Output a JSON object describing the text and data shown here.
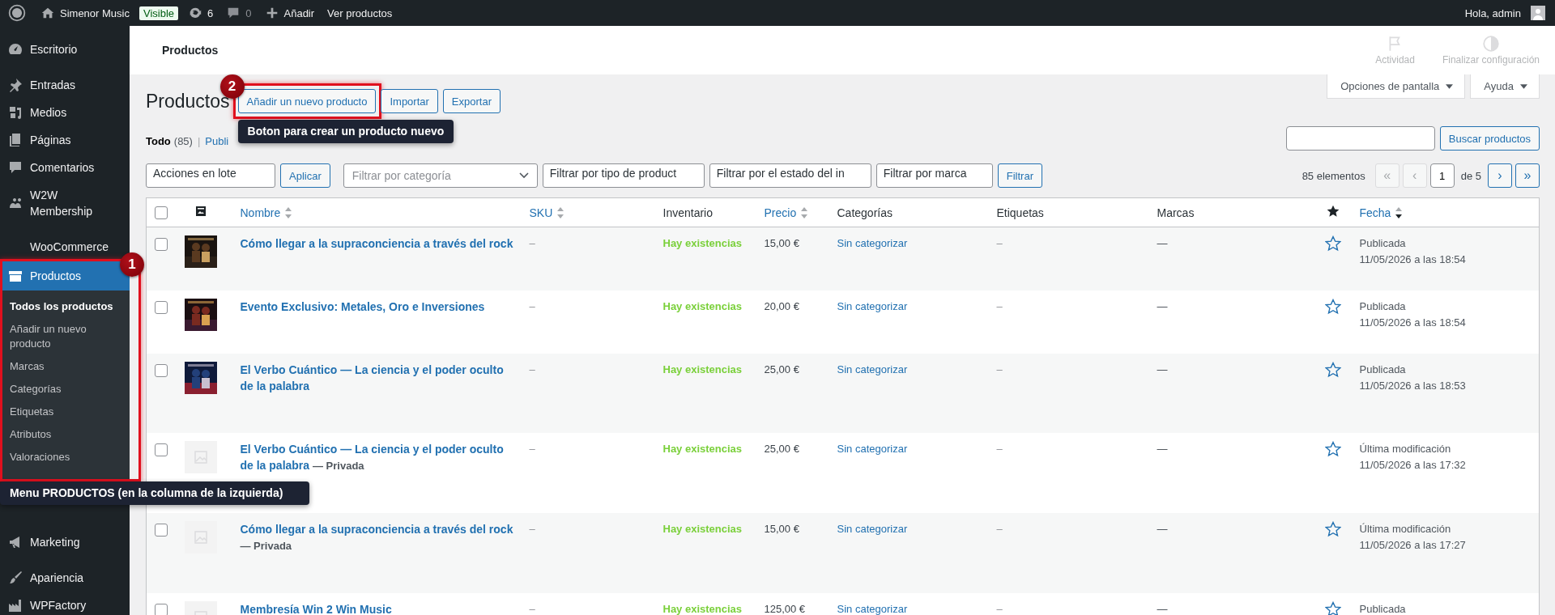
{
  "admin_bar": {
    "site": "Simenor Music",
    "visibility_badge": "Visible",
    "updates": "6",
    "comments": "0",
    "add": "Añadir",
    "view": "Ver productos",
    "greeting": "Hola, admin"
  },
  "sidebar": {
    "items": [
      {
        "label": "Escritorio",
        "selected": false
      },
      {
        "label": "Entradas",
        "selected": false
      },
      {
        "label": "Medios",
        "selected": false
      },
      {
        "label": "Páginas",
        "selected": false
      },
      {
        "label": "Comentarios",
        "selected": false
      },
      {
        "label": "W2W Membership",
        "selected": false
      },
      {
        "label": "WooCommerce",
        "selected": false
      },
      {
        "label": "Productos",
        "selected": true,
        "annotation": {
          "number": "1",
          "note": "Menu PRODUCTOS (en la columna de la izquierda)"
        },
        "children": [
          {
            "label": "Todos los productos",
            "selected": true
          },
          {
            "label": "Añadir un nuevo producto",
            "selected": false
          },
          {
            "label": "Marcas",
            "selected": false
          },
          {
            "label": "Categorías",
            "selected": false
          },
          {
            "label": "Etiquetas",
            "selected": false
          },
          {
            "label": "Atributos",
            "selected": false
          },
          {
            "label": "Valoraciones",
            "selected": false
          }
        ]
      },
      {
        "label": "Marketing",
        "selected": false
      },
      {
        "label": "Apariencia",
        "selected": false
      },
      {
        "label": "WPFactory",
        "selected": false
      }
    ]
  },
  "header": {
    "title": "Productos",
    "activity": "Actividad",
    "finish_setup": "Finalizar configuración"
  },
  "screen_tabs": [
    "Opciones de pantalla",
    "Ayuda"
  ],
  "page": {
    "title": "Productos",
    "actions": [
      {
        "label": "Añadir un nuevo producto",
        "annotation": {
          "number": "2",
          "note": "Boton para crear un producto nuevo"
        }
      },
      {
        "label": "Importar"
      },
      {
        "label": "Exportar"
      }
    ]
  },
  "views": [
    {
      "label": "Todo",
      "count": "(85)",
      "selected": true
    },
    {
      "separator": "|",
      "label": "Publi",
      "selected": false
    }
  ],
  "search": {
    "button": "Buscar productos"
  },
  "bulk": {
    "value": "Acciones en lote",
    "apply": "Aplicar"
  },
  "filters": [
    {
      "kind": "dropdown",
      "value": "Filtrar por categoría"
    },
    {
      "kind": "combo",
      "value": "Filtrar por tipo de product"
    },
    {
      "kind": "combo",
      "value": "Filtrar por el estado del in"
    },
    {
      "kind": "combo",
      "value": "Filtrar por marca"
    }
  ],
  "filter_button": "Filtrar",
  "pagination": {
    "count": "85 elementos",
    "nav_before": [
      {
        "label": "«",
        "disabled": true
      },
      {
        "label": "‹",
        "disabled": true
      }
    ],
    "current": "1",
    "total": "de 5",
    "nav_after": [
      {
        "label": "›",
        "disabled": false
      },
      {
        "label": "»",
        "disabled": false
      }
    ]
  },
  "table": {
    "select_all_checked": false,
    "columns": [
      {
        "label": "Nombre",
        "kind": "sortable"
      },
      {
        "label": "SKU",
        "kind": "sortable"
      },
      {
        "label": "Inventario",
        "kind": "plain"
      },
      {
        "label": "Precio",
        "kind": "sortable"
      },
      {
        "label": "Categorías",
        "kind": "plain"
      },
      {
        "label": "Etiquetas",
        "kind": "plain"
      },
      {
        "label": "Marcas",
        "kind": "plain"
      },
      {
        "label": "Fecha",
        "kind": "sorted"
      }
    ],
    "rows": [
      {
        "checked": false,
        "kind": "picture",
        "name": "Cómo llegar a la supraconciencia a través del rock",
        "sku": "–",
        "stock": "Hay existencias",
        "price": "15,00 €",
        "category": "Sin categorizar",
        "tags": "–",
        "brands": "—",
        "featured": false,
        "date_status": "Publicada",
        "date": "11/05/2026 a las 18:54"
      },
      {
        "checked": false,
        "kind": "picture",
        "name": "Evento Exclusivo: Metales, Oro e Inversiones",
        "sku": "–",
        "stock": "Hay existencias",
        "price": "20,00 €",
        "category": "Sin categorizar",
        "tags": "–",
        "brands": "—",
        "featured": false,
        "date_status": "Publicada",
        "date": "11/05/2026 a las 18:54"
      },
      {
        "checked": false,
        "kind": "picture",
        "name": "El Verbo Cuántico — La ciencia y el poder oculto de la palabra",
        "sku": "–",
        "stock": "Hay existencias",
        "price": "25,00 €",
        "category": "Sin categorizar",
        "tags": "–",
        "brands": "—",
        "featured": false,
        "date_status": "Publicada",
        "date": "11/05/2026 a las 18:53"
      },
      {
        "checked": false,
        "kind": "placeholder",
        "name": "El Verbo Cuántico — La ciencia y el poder oculto de la palabra",
        "status": "— Privada",
        "sku": "–",
        "stock": "Hay existencias",
        "price": "25,00 €",
        "category": "Sin categorizar",
        "tags": "–",
        "brands": "—",
        "featured": false,
        "date_status": "Última modificación",
        "date": "11/05/2026 a las 17:32"
      },
      {
        "checked": false,
        "kind": "placeholder",
        "name": "Cómo llegar a la supraconciencia a través del rock",
        "status": "— Privada",
        "sku": "–",
        "stock": "Hay existencias",
        "price": "15,00 €",
        "category": "Sin categorizar",
        "tags": "–",
        "brands": "—",
        "featured": false,
        "date_status": "Última modificación",
        "date": "11/05/2026 a las 17:27"
      },
      {
        "checked": false,
        "kind": "placeholder",
        "name": "Membresía Win 2 Win Music",
        "sku": "–",
        "stock": "Hay existencias",
        "price": "125,00 €",
        "category": "Sin categorizar",
        "tags": "–",
        "brands": "—",
        "featured": false,
        "date_status": "Publicada"
      }
    ]
  }
}
